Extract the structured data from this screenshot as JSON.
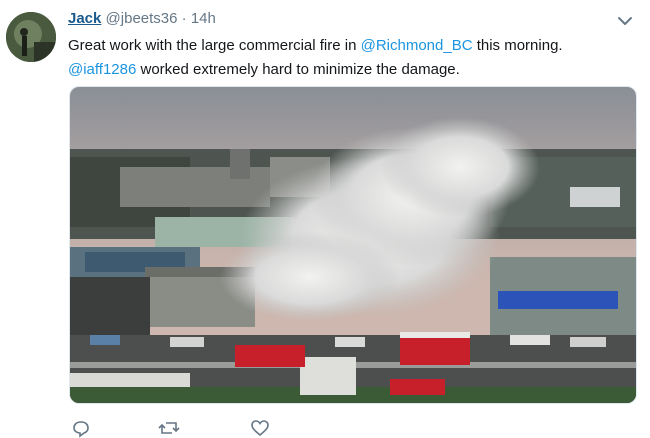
{
  "tweet": {
    "author_name": "Jack",
    "author_handle": "@jbeets36",
    "separator": "·",
    "timestamp": "14h",
    "text_part1": "Great work with the large commercial fire in ",
    "mention1": "@Richmond_BC",
    "text_part2": " this morning.",
    "mention2": "@iaff1286",
    "text_part3": " worked extremely hard to minimize the damage.",
    "mention_color": "#1b95e0"
  },
  "actions": {
    "icons": [
      "reply-icon",
      "retweet-icon",
      "like-icon"
    ]
  }
}
